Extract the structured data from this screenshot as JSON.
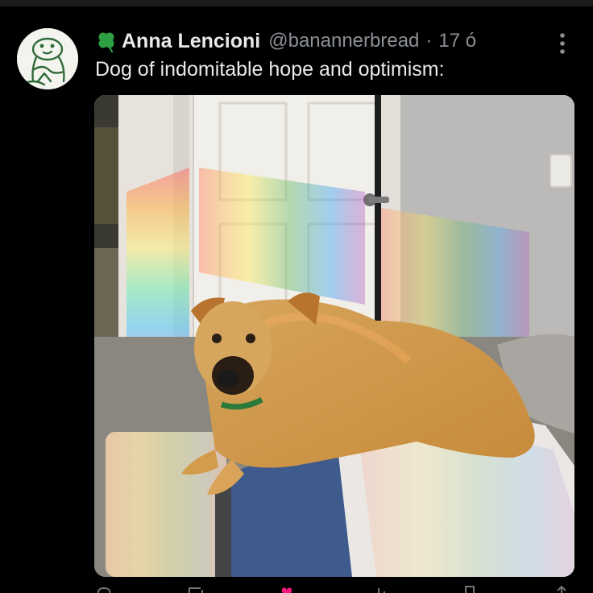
{
  "tweet": {
    "display_name": "Anna Lencioni",
    "handle": "@banannerbread",
    "separator": "·",
    "time": "17 ó",
    "text": "Dog of indomitable hope and optimism:",
    "name_badge_icon": "four-leaf-clover-icon",
    "menu_icon": "more-vertical-icon"
  },
  "actions": [
    "reply-icon",
    "repost-icon",
    "like-icon",
    "views-icon",
    "bookmark-icon",
    "share-icon"
  ],
  "colors": {
    "background": "#000000",
    "name_text": "#e7e9ea",
    "secondary_text": "#8b9096",
    "clover": "#2ea043",
    "like": "#f91880"
  }
}
